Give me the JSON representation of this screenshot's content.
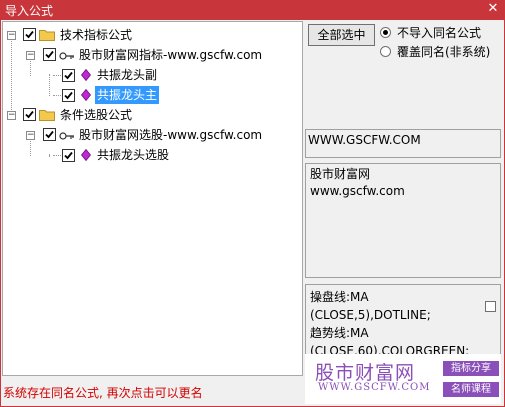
{
  "window": {
    "title": "导入公式",
    "close_glyph": "✕"
  },
  "tree": {
    "root1": {
      "label": "技术指标公式",
      "checked": true
    },
    "group1": {
      "label": "股市财富网指标-www.gscfw.com",
      "checked": true
    },
    "item1": {
      "label": "共振龙头副",
      "checked": true
    },
    "item2": {
      "label": "共振龙头主",
      "checked": true,
      "selected": true
    },
    "root2": {
      "label": "条件选股公式",
      "checked": true
    },
    "group2": {
      "label": "股市财富网选股-www.gscfw.com",
      "checked": true
    },
    "item3": {
      "label": "共振龙头选股",
      "checked": true
    }
  },
  "controls": {
    "select_all_label": "全部选中",
    "radio_skip_label": "不导入同名公式",
    "radio_overwrite_label": "覆盖同名(非系统)"
  },
  "info": {
    "url": "WWW.GSCFW.COM",
    "desc_line1": "股市财富网",
    "desc_line2": "www.gscfw.com"
  },
  "code": {
    "line1": "操盘线:MA",
    "line2": "(CLOSE,5),DOTLINE;",
    "line3": "趋势线:MA",
    "line4": "(CLOSE,60),COLORGREEN;"
  },
  "status": {
    "message": "系统存在同名公式, 再次点击可以更名"
  },
  "watermark": {
    "brand": "股市财富网",
    "url": "WWW.GSCFW.COM",
    "tag1": "指标分享",
    "tag2": "名师课程"
  },
  "colors": {
    "titlebar": "#c8363b",
    "selection": "#3399ff",
    "status_text": "#d40000",
    "watermark": "#8a4fb8",
    "folder": "#f2c94c",
    "gem": "#c026d3"
  }
}
